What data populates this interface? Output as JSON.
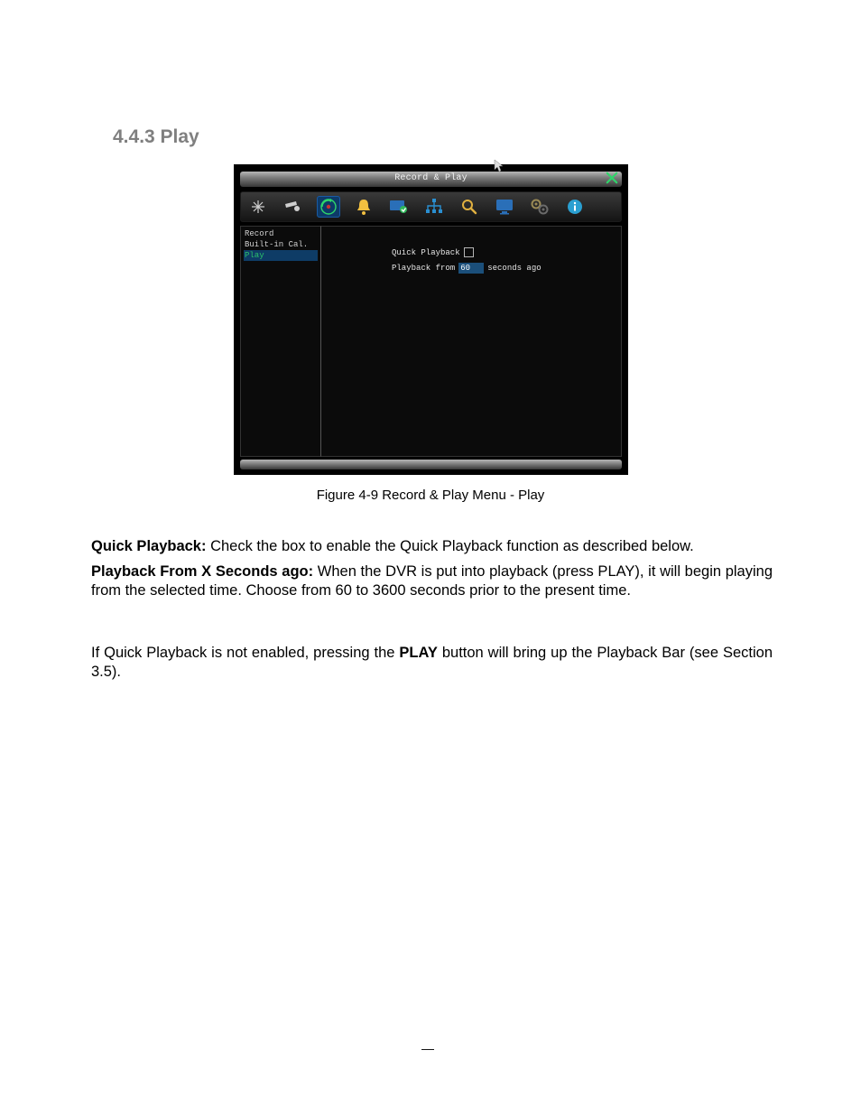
{
  "heading": "4.4.3  Play",
  "figure": {
    "title": "Record & Play",
    "sidebar": {
      "items": [
        "Record",
        "Built-in Cal.",
        "Play"
      ],
      "active_index": 2
    },
    "content": {
      "quick_playback_label": "Quick Playback",
      "quick_playback_checked": false,
      "playback_from_prefix": "Playback from",
      "playback_from_value": "60",
      "playback_from_suffix": "seconds ago"
    },
    "toolbar_icons": [
      "sparkle-icon",
      "camera-icon",
      "record-play-icon",
      "bell-icon",
      "monitor-check-icon",
      "network-icon",
      "search-icon",
      "display-icon",
      "gear-icon",
      "info-icon"
    ],
    "selected_toolbar_index": 2,
    "caption": "Figure 4-9 Record & Play Menu - Play"
  },
  "paragraphs": {
    "p1_bold": "Quick Playback:",
    "p1_rest": " Check the box to enable the Quick Playback function as described below.",
    "p2_bold": "Playback From X Seconds ago:",
    "p2_rest_a": " When the DVR is put into playback (press PLAY), it will begin playing from the selected time. Choose from 60 to 3600 seconds prior to the present time.",
    "p3_a": "If Quick Playback is not enabled, pressing the ",
    "p3_bold": "PLAY",
    "p3_b": " button will bring up the Playback Bar (see Section 3.5)."
  }
}
